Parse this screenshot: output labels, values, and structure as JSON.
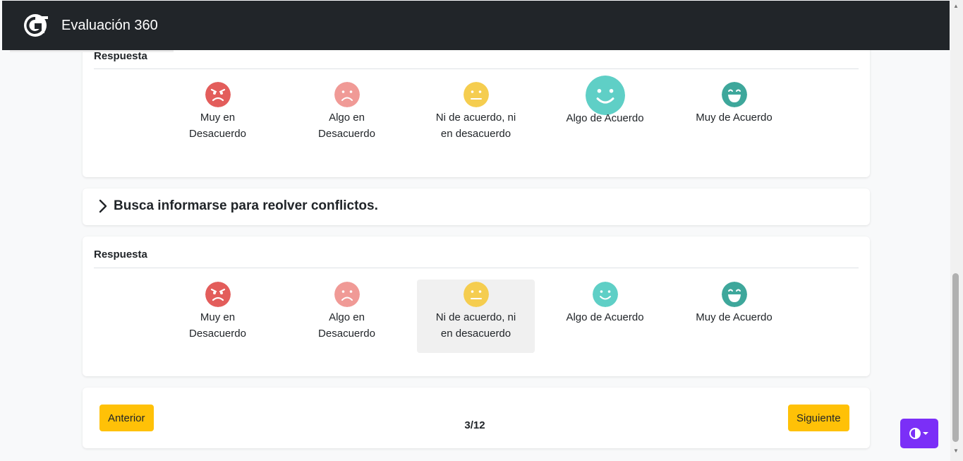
{
  "header": {
    "title": "Evaluación 360",
    "logo_icon": "gt-logo-icon"
  },
  "colors": {
    "header_bg": "#212529",
    "accent_yellow": "#ffc107",
    "theme_button": "#7b2ff7",
    "face_very_disagree": "#e35d5b",
    "face_disagree": "#f09a96",
    "face_neutral": "#f5cd4f",
    "face_agree": "#5fcfc6",
    "face_very_agree": "#3ea79b"
  },
  "block1": {
    "response_label": "Respuesta",
    "options": [
      {
        "label": "Muy en Desacuerdo",
        "icon": "angry-face-icon"
      },
      {
        "label": "Algo en Desacuerdo",
        "icon": "sad-face-icon"
      },
      {
        "label": "Ni de acuerdo, ni en desacuerdo",
        "icon": "neutral-face-icon"
      },
      {
        "label": "Algo de Acuerdo",
        "icon": "smile-face-icon"
      },
      {
        "label": "Muy de Acuerdo",
        "icon": "grin-face-icon"
      }
    ]
  },
  "question2": {
    "text": "Busca informarse para reolver conflictos."
  },
  "block2": {
    "response_label": "Respuesta",
    "options": [
      {
        "label": "Muy en Desacuerdo",
        "icon": "angry-face-icon"
      },
      {
        "label": "Algo en Desacuerdo",
        "icon": "sad-face-icon"
      },
      {
        "label": "Ni de acuerdo, ni en desacuerdo",
        "icon": "neutral-face-icon",
        "selected": true
      },
      {
        "label": "Algo de Acuerdo",
        "icon": "smile-face-icon"
      },
      {
        "label": "Muy de Acuerdo",
        "icon": "grin-face-icon"
      }
    ]
  },
  "navigation": {
    "prev_label": "Anterior",
    "next_label": "Siguiente",
    "page_indicator": "3/12"
  },
  "theme_toggle_icon": "contrast-icon"
}
